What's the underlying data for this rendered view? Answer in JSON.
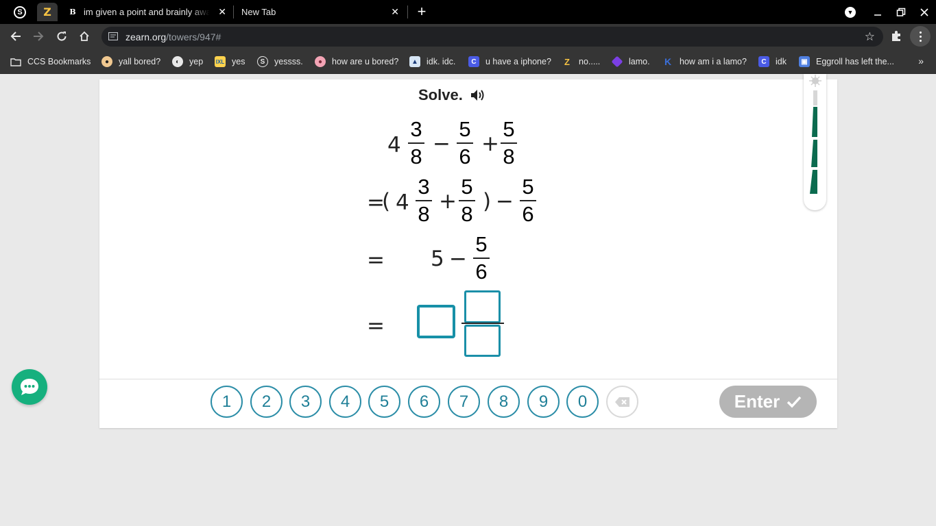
{
  "browser": {
    "tabs": [
      {
        "title": "im given a point and brainly away",
        "favicon": "brainly-icon",
        "active": false
      },
      {
        "title": "New Tab",
        "favicon": "",
        "active": false
      }
    ],
    "url_host": "zearn.org",
    "url_path": "/towers/947#"
  },
  "bookmarks": [
    {
      "label": "CCS Bookmarks",
      "icon": "folder-icon"
    },
    {
      "label": "yall bored?",
      "icon": "face-icon"
    },
    {
      "label": "yep",
      "icon": "globe-icon"
    },
    {
      "label": "yes",
      "icon": "ixl-icon"
    },
    {
      "label": "yessss.",
      "icon": "s-icon"
    },
    {
      "label": "how are u bored?",
      "icon": "pig-icon"
    },
    {
      "label": "idk. idc.",
      "icon": "bot-icon"
    },
    {
      "label": "u have a iphone?",
      "icon": "c-icon"
    },
    {
      "label": "no.....",
      "icon": "z-icon"
    },
    {
      "label": "lamo.",
      "icon": "diamond-icon"
    },
    {
      "label": "how am i a lamo?",
      "icon": "k-icon"
    },
    {
      "label": "idk",
      "icon": "c-icon"
    },
    {
      "label": "Eggroll has left the...",
      "icon": "classroom-icon"
    }
  ],
  "prompt": {
    "title": "Solve."
  },
  "problem": {
    "line1": {
      "whole": "4",
      "f1_num": "3",
      "f1_den": "8",
      "op1": "−",
      "f2_num": "5",
      "f2_den": "6",
      "op2": "+",
      "f3_num": "5",
      "f3_den": "8"
    },
    "line2": {
      "eq": "=",
      "lparen": "(",
      "whole": "4",
      "f1_num": "3",
      "f1_den": "8",
      "op1": "+",
      "f2_num": "5",
      "f2_den": "8",
      "rparen": ")",
      "op2": "−",
      "f3_num": "5",
      "f3_den": "6"
    },
    "line3": {
      "eq": "=",
      "whole": "5",
      "op": "−",
      "f_num": "5",
      "f_den": "6"
    },
    "line4": {
      "eq": "="
    }
  },
  "keypad": {
    "keys": [
      "1",
      "2",
      "3",
      "4",
      "5",
      "6",
      "7",
      "8",
      "9",
      "0"
    ],
    "enter_label": "Enter"
  },
  "colors": {
    "accent": "#1b8fa8",
    "tower_green": "#0b6b4f",
    "chat_green": "#16b07e",
    "enter_disabled": "#b5b5b5"
  }
}
